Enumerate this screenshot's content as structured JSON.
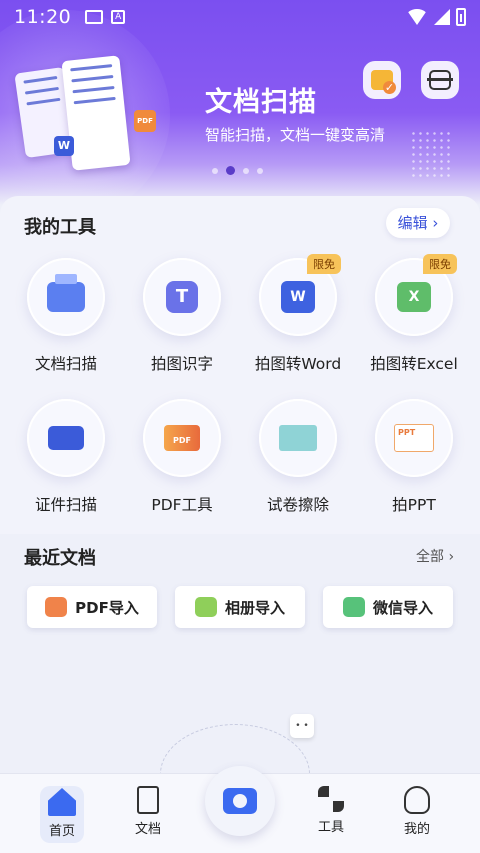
{
  "status_bar": {
    "time": "11:20"
  },
  "hero": {
    "title": "文档扫描",
    "subtitle": "智能扫描，文档一键变高清",
    "word_badge": "W",
    "pdf_badge": "PDF",
    "carousel": {
      "count": 4,
      "active_index": 1
    }
  },
  "tools_section": {
    "title": "我的工具",
    "edit_label": "编辑 ›",
    "items": [
      {
        "label": "文档扫描",
        "icon": "printer-icon",
        "badge": ""
      },
      {
        "label": "拍图识字",
        "icon": "text-recognize-icon",
        "badge": ""
      },
      {
        "label": "拍图转Word",
        "icon": "word-icon",
        "badge": "限免"
      },
      {
        "label": "拍图转Excel",
        "icon": "excel-icon",
        "badge": "限免"
      },
      {
        "label": "证件扫描",
        "icon": "id-card-icon",
        "badge": ""
      },
      {
        "label": "PDF工具",
        "icon": "pdf-icon",
        "badge": ""
      },
      {
        "label": "试卷擦除",
        "icon": "test-paper-icon",
        "badge": ""
      },
      {
        "label": "拍PPT",
        "icon": "ppt-icon",
        "badge": ""
      }
    ]
  },
  "recent_section": {
    "title": "最近文档",
    "all_label": "全部 ›",
    "imports": [
      {
        "label": "PDF导入",
        "icon": "pdf-import-icon",
        "color": "#f0834a"
      },
      {
        "label": "相册导入",
        "icon": "album-import-icon",
        "color": "#8fcf5a"
      },
      {
        "label": "微信导入",
        "icon": "wechat-import-icon",
        "color": "#57c27a"
      }
    ]
  },
  "bottom_nav": {
    "items": [
      {
        "label": "首页",
        "icon": "home-icon",
        "active": true
      },
      {
        "label": "文档",
        "icon": "document-icon",
        "active": false
      },
      {
        "label": "工具",
        "icon": "tools-icon",
        "active": false
      },
      {
        "label": "我的",
        "icon": "user-icon",
        "active": false
      }
    ],
    "camera": "camera-icon"
  },
  "colors": {
    "primary": "#3b6af0",
    "hero": "#7b4ff0",
    "badge": "#f7c35a"
  }
}
